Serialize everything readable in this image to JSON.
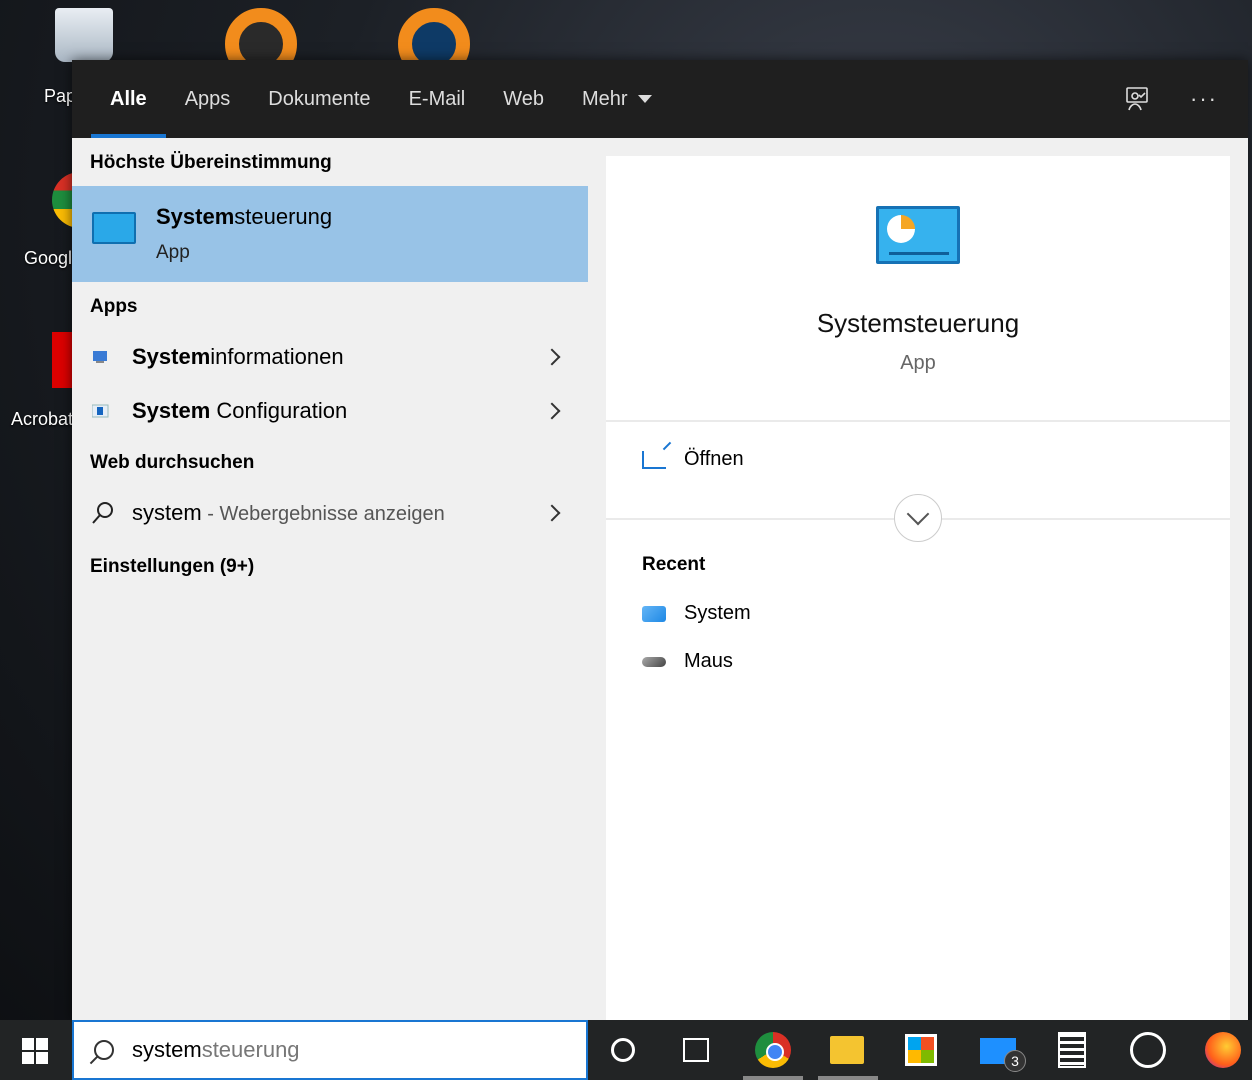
{
  "desktop": {
    "icons": [
      {
        "label": "Pap"
      },
      {
        "label": "Googl"
      },
      {
        "label": "Acrobat"
      }
    ]
  },
  "search": {
    "tabs": [
      {
        "label": "Alle",
        "active": true
      },
      {
        "label": "Apps"
      },
      {
        "label": "Dokumente"
      },
      {
        "label": "E-Mail"
      },
      {
        "label": "Web"
      },
      {
        "label": "Mehr"
      }
    ],
    "actions": {
      "more": "···"
    },
    "best_match": {
      "heading": "Höchste Übereinstimmung",
      "name_bold": "System",
      "name_rest": "steuerung",
      "type": "App"
    },
    "apps": {
      "heading": "Apps",
      "items": [
        {
          "bold": "System",
          "rest": "informationen"
        },
        {
          "bold": "System",
          "rest": " Configuration"
        }
      ]
    },
    "web": {
      "heading": "Web durchsuchen",
      "query": "system",
      "hint": " - Webergebnisse anzeigen"
    },
    "settings": {
      "heading": "Einstellungen (9+)"
    },
    "detail": {
      "name": "Systemsteuerung",
      "type": "App",
      "open_label": "Öffnen",
      "recent_heading": "Recent",
      "recent": [
        {
          "label": "System"
        },
        {
          "label": "Maus"
        }
      ]
    },
    "box": {
      "typed": "system",
      "completion": "steuerung"
    }
  },
  "taskbar": {
    "mail_badge": "3"
  },
  "colors": {
    "accent": "#1976d2",
    "selected_row": "#98c3e7",
    "topbar": "#1f1f1f",
    "taskbar": "#222425"
  }
}
